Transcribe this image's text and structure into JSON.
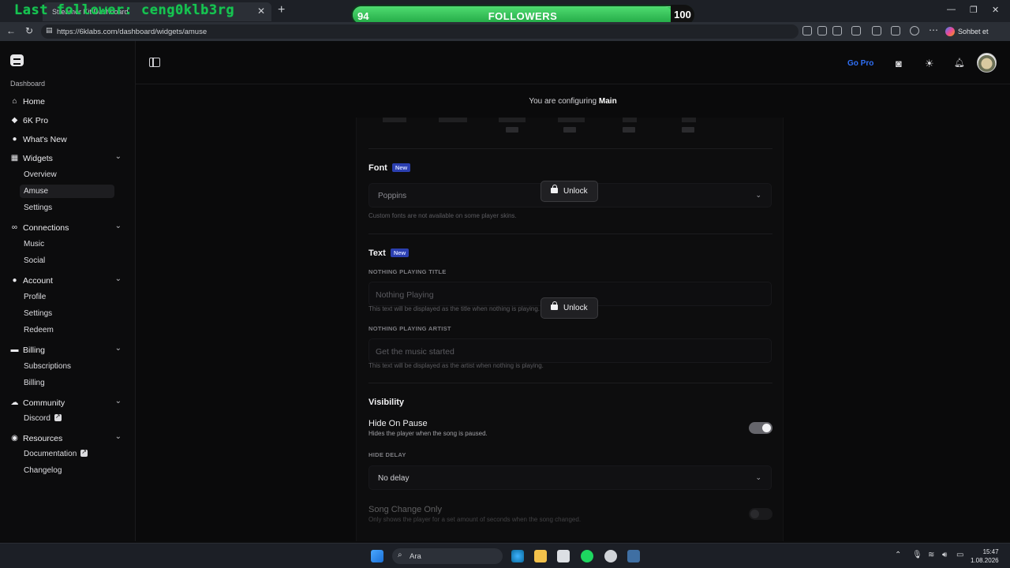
{
  "browser": {
    "tab_title": "Streamer Kit Dashboard",
    "overlay_text": "Last follower: ceng0klb3rg",
    "url": "https://6klabs.com/dashboard/widgets/amuse",
    "profile_label": "Sohbet et"
  },
  "followers_widget": {
    "current": "94",
    "label": "FOLLOWERS",
    "goal": "100",
    "progress": 0.94
  },
  "sidebar": {
    "section_label": "Dashboard",
    "items": [
      {
        "label": "Home",
        "icon": "home-icon",
        "glyph": "⌂"
      },
      {
        "label": "6K Pro",
        "icon": "gem-icon",
        "glyph": "◆"
      },
      {
        "label": "What's New",
        "icon": "bell-icon",
        "glyph": "●"
      },
      {
        "label": "Widgets",
        "icon": "grid-icon",
        "glyph": "▦",
        "expanded": true,
        "children": [
          {
            "label": "Overview"
          },
          {
            "label": "Amuse",
            "active": true
          },
          {
            "label": "Settings"
          }
        ]
      },
      {
        "label": "Connections",
        "icon": "link-icon",
        "glyph": "∞",
        "expanded": true,
        "children": [
          {
            "label": "Music"
          },
          {
            "label": "Social"
          }
        ]
      },
      {
        "label": "Account",
        "icon": "user-icon",
        "glyph": "●",
        "expanded": true,
        "children": [
          {
            "label": "Profile"
          },
          {
            "label": "Settings"
          },
          {
            "label": "Redeem"
          }
        ]
      },
      {
        "label": "Billing",
        "icon": "card-icon",
        "glyph": "▬",
        "expanded": true,
        "children": [
          {
            "label": "Subscriptions"
          },
          {
            "label": "Billing"
          }
        ]
      },
      {
        "label": "Community",
        "icon": "chat-icon",
        "glyph": "☁",
        "expanded": true,
        "children": [
          {
            "label": "Discord",
            "external": true
          }
        ]
      },
      {
        "label": "Resources",
        "icon": "globe-icon",
        "glyph": "◉",
        "expanded": true,
        "children": [
          {
            "label": "Documentation",
            "external": true
          },
          {
            "label": "Changelog"
          }
        ]
      }
    ]
  },
  "topbar": {
    "go_pro": "Go Pro"
  },
  "header": {
    "configuring_prefix": "You are configuring",
    "configuring_name": "Main"
  },
  "font_section": {
    "title": "Font",
    "badge": "New",
    "value": "Poppins",
    "help": "Custom fonts are not available on some player skins.",
    "unlock_label": "Unlock"
  },
  "text_section": {
    "title": "Text",
    "badge": "New",
    "np_title_label": "NOTHING PLAYING TITLE",
    "np_title_placeholder": "Nothing Playing",
    "np_title_help": "This text will be displayed as the title when nothing is playing.",
    "np_artist_label": "NOTHING PLAYING ARTIST",
    "np_artist_placeholder": "Get the music started",
    "np_artist_help": "This text will be displayed as the artist when nothing is playing.",
    "unlock_label": "Unlock"
  },
  "visibility_section": {
    "title": "Visibility",
    "hide_on_pause_title": "Hide On Pause",
    "hide_on_pause_desc": "Hides the player when the song is paused.",
    "hide_on_pause_enabled": true,
    "hide_delay_label": "HIDE DELAY",
    "hide_delay_value": "No delay",
    "song_change_title": "Song Change Only",
    "song_change_desc": "Only shows the player for a set amount of seconds when the song changed.",
    "song_change_enabled": false
  },
  "taskbar": {
    "search_label": "Ara",
    "time": "15:47",
    "date": "1.08.2026"
  }
}
